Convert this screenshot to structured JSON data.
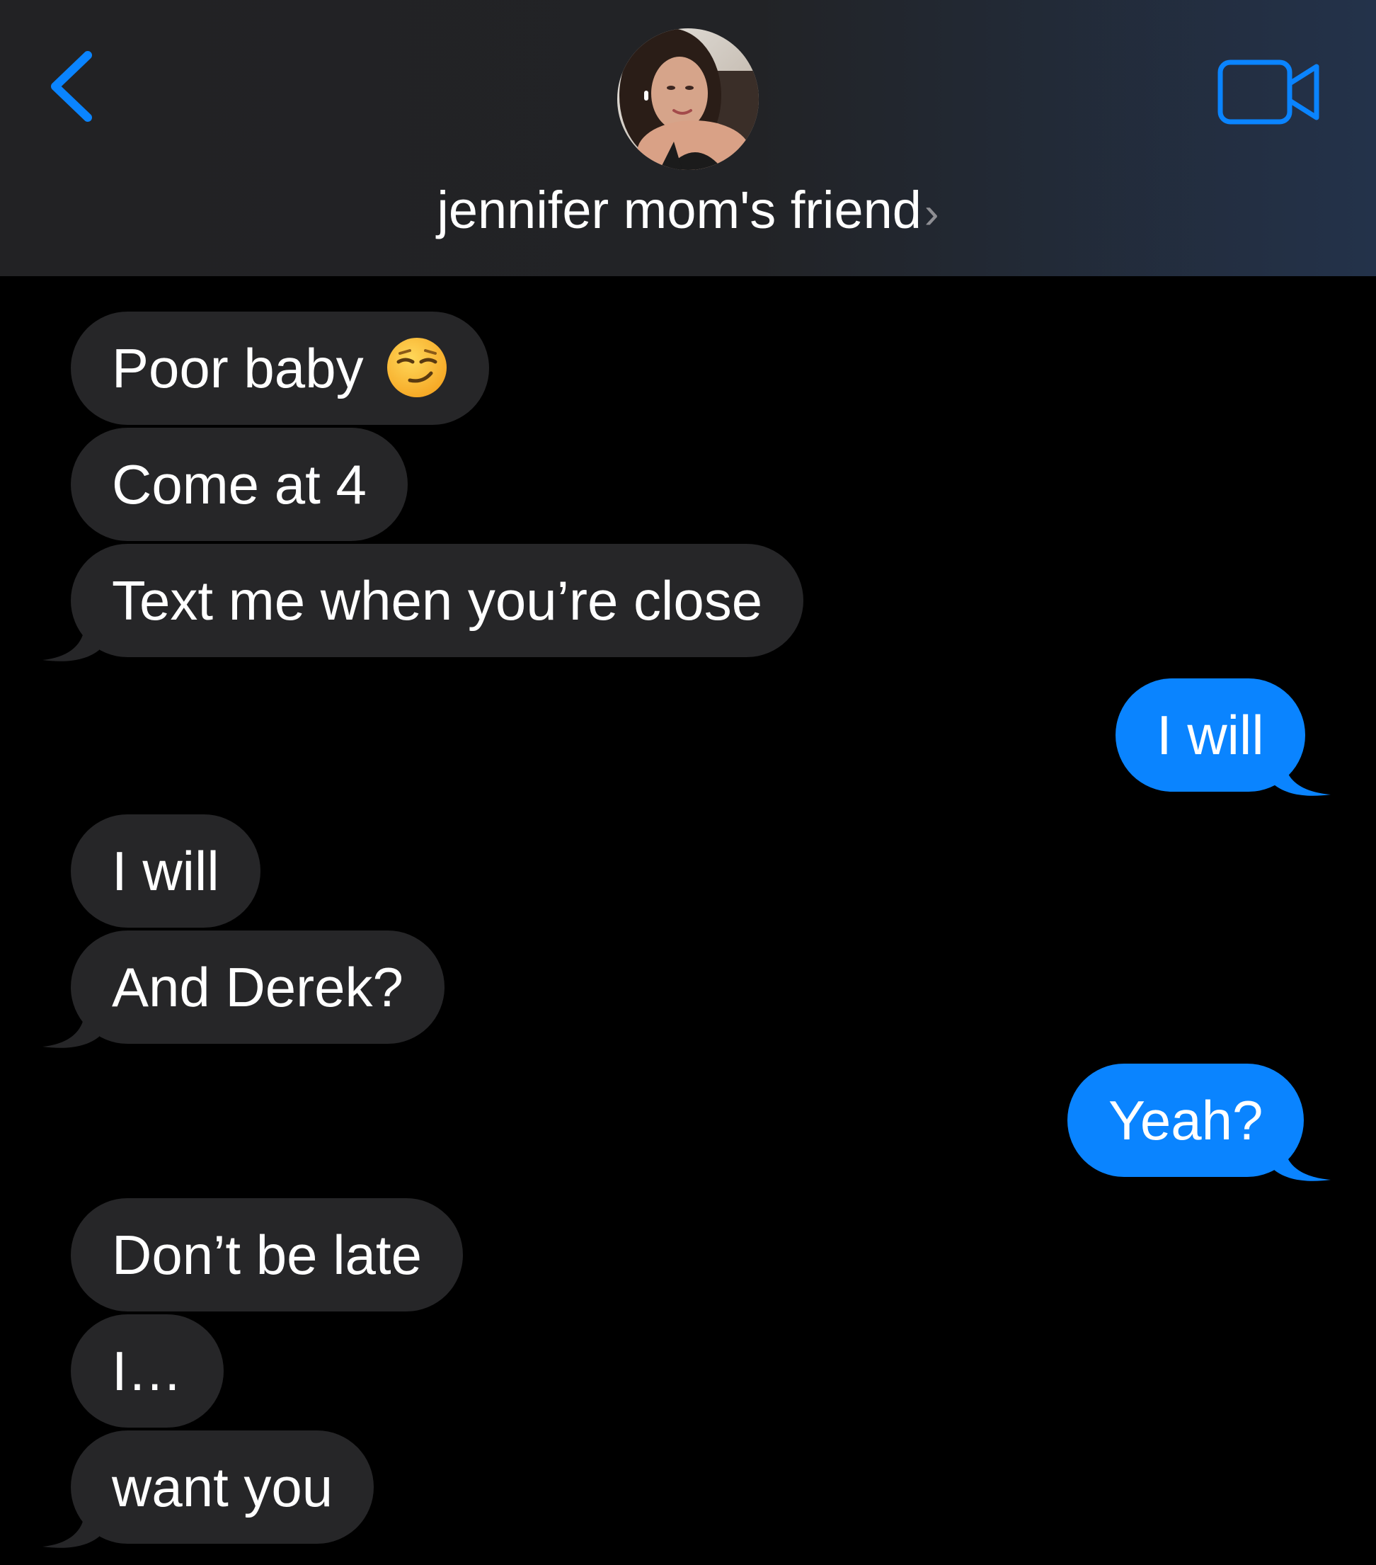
{
  "header": {
    "contact_name": "jennifer mom's friend",
    "chevron": "›",
    "back_icon": "chevron-left-icon",
    "video_icon": "video-camera-icon",
    "accent_color": "#0a84ff"
  },
  "messages": [
    {
      "direction": "received",
      "text": "Poor baby",
      "emoji": "smirking-face"
    },
    {
      "direction": "received",
      "text": "Come at 4"
    },
    {
      "direction": "received",
      "text": "Text me when you’re close"
    },
    {
      "direction": "sent",
      "text": "I will"
    },
    {
      "direction": "received",
      "text": "I will"
    },
    {
      "direction": "received",
      "text": "And Derek?"
    },
    {
      "direction": "sent",
      "text": "Yeah?"
    },
    {
      "direction": "received",
      "text": "Don’t be late"
    },
    {
      "direction": "received",
      "text": "I…"
    },
    {
      "direction": "received",
      "text": "want you"
    }
  ],
  "colors": {
    "received_bubble": "#262628",
    "sent_bubble": "#0a84ff",
    "background": "#000000"
  }
}
